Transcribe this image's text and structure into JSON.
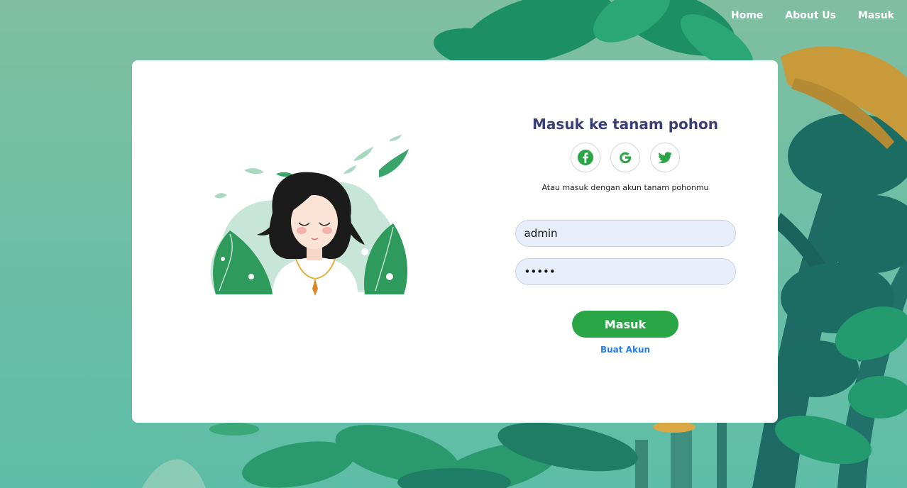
{
  "nav": {
    "items": [
      {
        "label": "Home"
      },
      {
        "label": "About Us"
      },
      {
        "label": "Masuk"
      }
    ]
  },
  "login": {
    "title": "Masuk ke tanam pohon",
    "social": [
      {
        "icon": "facebook-icon",
        "color": "#2aa646"
      },
      {
        "icon": "google-icon",
        "color": "#2aa646"
      },
      {
        "icon": "twitter-icon",
        "color": "#2aa646"
      }
    ],
    "subtitle": "Atau masuk dengan akun tanam pohonmu",
    "username_value": "admin",
    "password_value": "admin",
    "submit_label": "Masuk",
    "create_account_label": "Buat Akun"
  },
  "colors": {
    "accent": "#2aa646",
    "title": "#3a3f7a",
    "link": "#2b7de9",
    "input_bg": "#e8eefa"
  }
}
